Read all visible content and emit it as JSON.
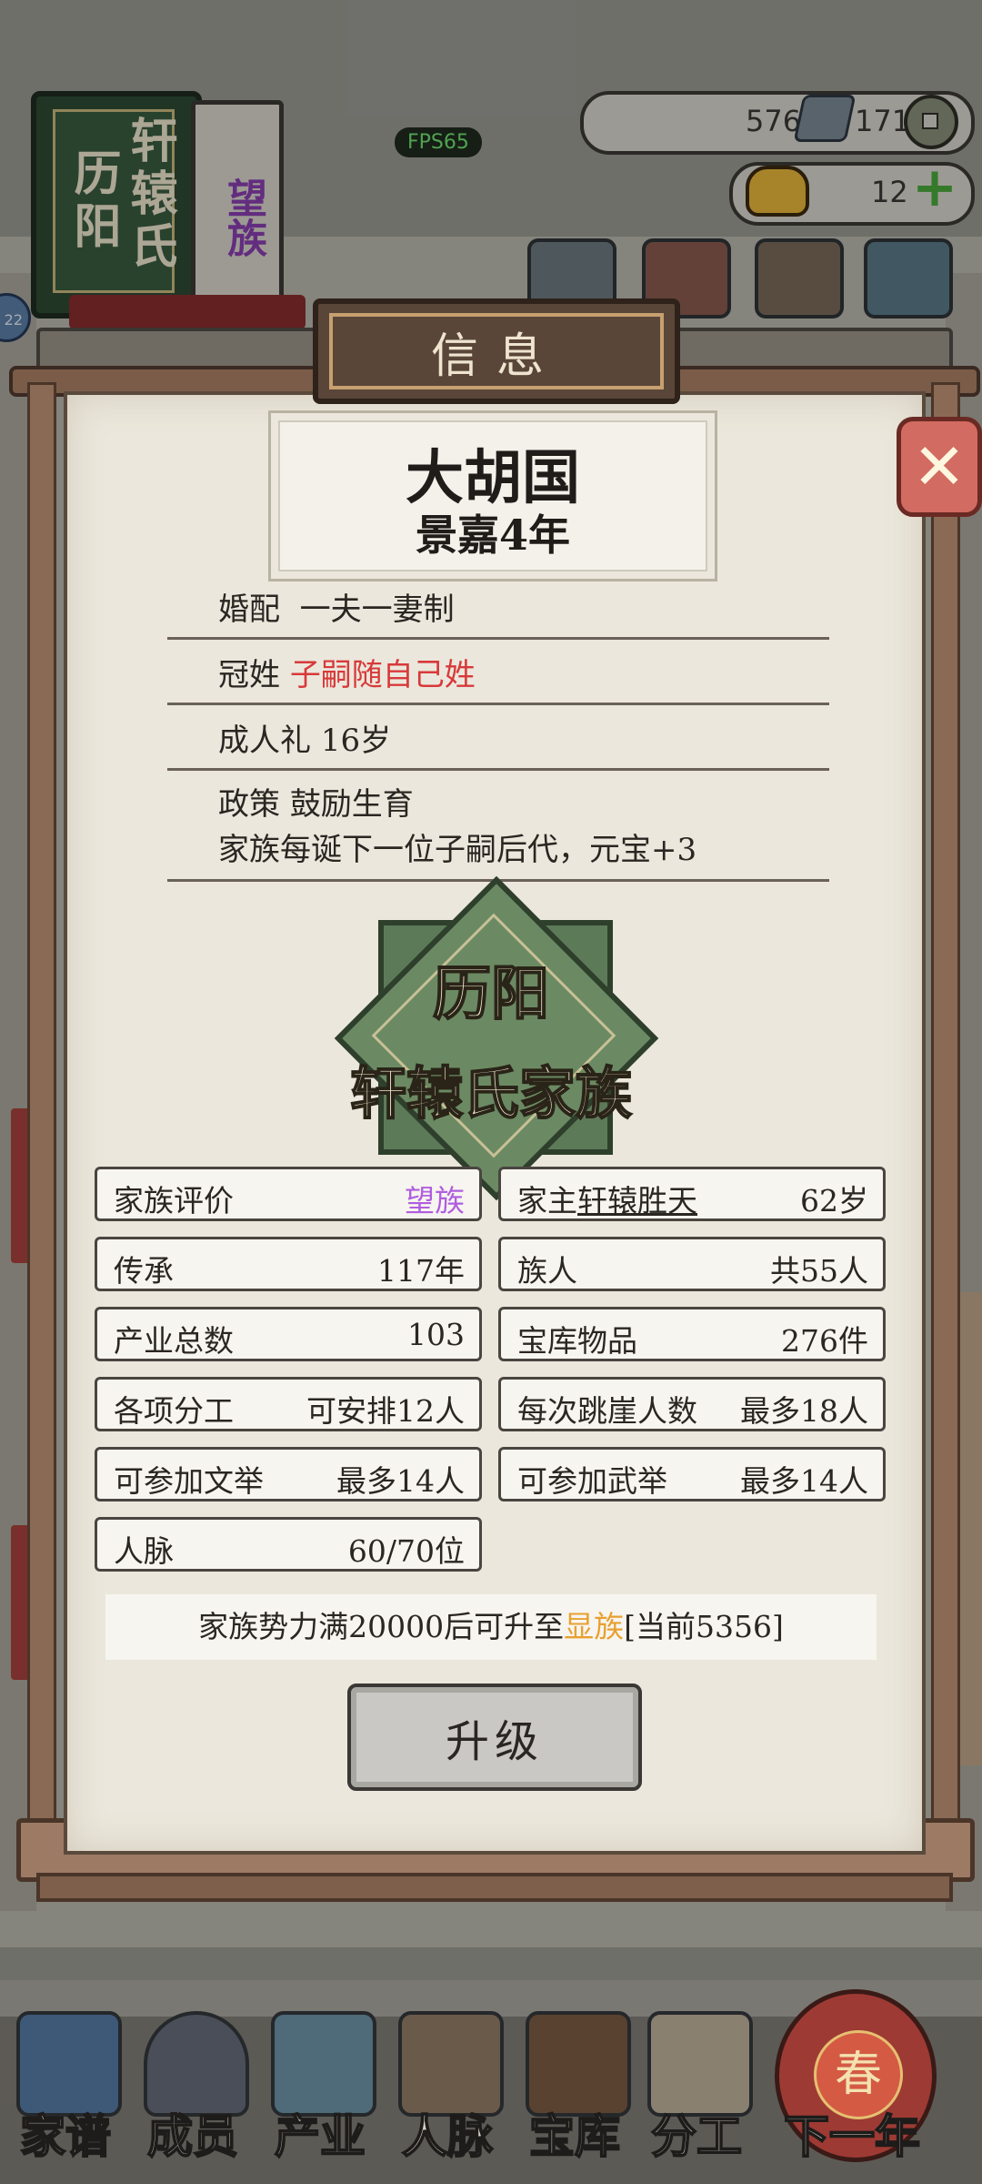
{
  "hud": {
    "family_book": {
      "place": "历阳",
      "clan": "轩辕氏",
      "rank": "望族"
    },
    "fps": "FPS65",
    "silver": "576",
    "coins": "171",
    "gold": "12",
    "edge_badge": "22"
  },
  "panel": {
    "title": "信息",
    "close_glyph": "✕",
    "nation": {
      "name": "大胡国",
      "era": "景嘉4年"
    },
    "policies": [
      {
        "label": "婚配",
        "value": "一夫一妻制"
      },
      {
        "label": "冠姓",
        "value": "子嗣随自己姓"
      },
      {
        "label": "成人礼",
        "value": "16岁"
      },
      {
        "label": "政策",
        "value": "鼓励生育",
        "desc": "家族每诞下一位子嗣后代，元宝+3"
      }
    ],
    "emblem": {
      "place": "历阳",
      "clan": "轩辕氏家族"
    },
    "stats": {
      "rating": {
        "label": "家族评价",
        "value": "望族"
      },
      "head": {
        "label": "家主",
        "name": "轩辕胜天",
        "value": "62岁"
      },
      "heritage": {
        "label": "传承",
        "value": "117年"
      },
      "members": {
        "label": "族人",
        "value": "共55人"
      },
      "industry": {
        "label": "产业总数",
        "value": "103"
      },
      "treasury": {
        "label": "宝库物品",
        "value": "276件"
      },
      "labor": {
        "label": "各项分工",
        "value": "可安排12人"
      },
      "cliff": {
        "label": "每次跳崖人数",
        "value": "最多18人"
      },
      "civil_exam": {
        "label": "可参加文举",
        "value": "最多14人"
      },
      "military_exam": {
        "label": "可参加武举",
        "value": "最多14人"
      },
      "network": {
        "label": "人脉",
        "value": "60/70位"
      }
    },
    "upgrade_note": {
      "pre": "家族势力满20000后可升至",
      "rank": "显族",
      "post": "[当前5356]"
    },
    "upgrade_button": "升级"
  },
  "nav": {
    "items": [
      "家谱",
      "成员",
      "产业",
      "人脉",
      "宝库",
      "分工",
      "下一年"
    ],
    "lantern": "春"
  },
  "colors": {
    "panel_bg": "#ebe7dc",
    "red_text": "#d8393a",
    "purple_text": "#b05ee0",
    "orange_text": "#e8a030",
    "emblem_green": "#6b8a63"
  }
}
